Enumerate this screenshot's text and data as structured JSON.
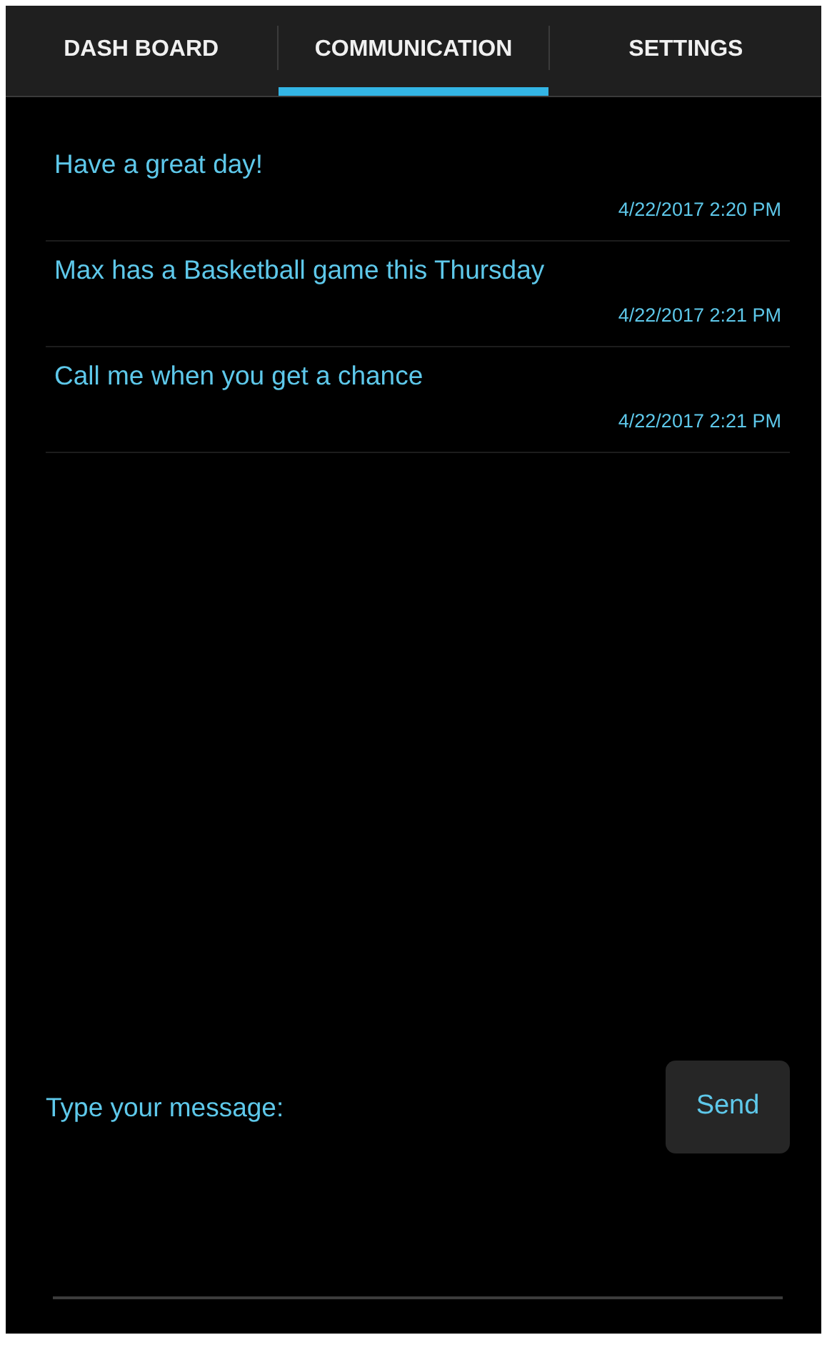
{
  "tabs": [
    {
      "label": "DASH BOARD",
      "selected": false
    },
    {
      "label": "COMMUNICATION",
      "selected": true
    },
    {
      "label": "SETTINGS",
      "selected": false
    }
  ],
  "messages": [
    {
      "text": "Have a great day!",
      "time": "4/22/2017 2:20 PM"
    },
    {
      "text": "Max has a Basketball game this Thursday",
      "time": "4/22/2017 2:21 PM"
    },
    {
      "text": "Call me when you get a chance",
      "time": "4/22/2017 2:21 PM"
    }
  ],
  "composer": {
    "label": "Type your message:",
    "send_button": "Send"
  }
}
